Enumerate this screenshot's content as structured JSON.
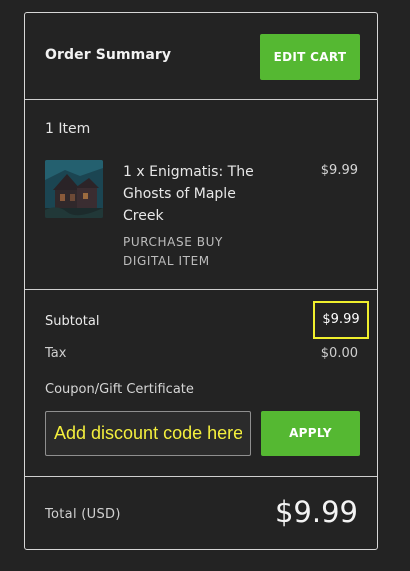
{
  "order_summary": {
    "title": "Order Summary",
    "edit_cart_label": "EDIT CART"
  },
  "cart": {
    "item_count": "1 Item",
    "items": [
      {
        "name": "1 x Enigmatis: The Ghosts of Maple Creek",
        "type": "PURCHASE BUY DIGITAL ITEM",
        "price": "$9.99"
      }
    ]
  },
  "totals": {
    "subtotal_label": "Subtotal",
    "subtotal_value": "$9.99",
    "tax_label": "Tax",
    "tax_value": "$0.00",
    "total_label": "Total (USD)",
    "total_value": "$9.99"
  },
  "coupon": {
    "label": "Coupon/Gift Certificate",
    "placeholder": "Add discount code here",
    "apply_label": "APPLY"
  },
  "colors": {
    "accent": "#55b832",
    "highlight": "#f0ef2d",
    "background": "#232323",
    "border": "#d7d7d7"
  }
}
